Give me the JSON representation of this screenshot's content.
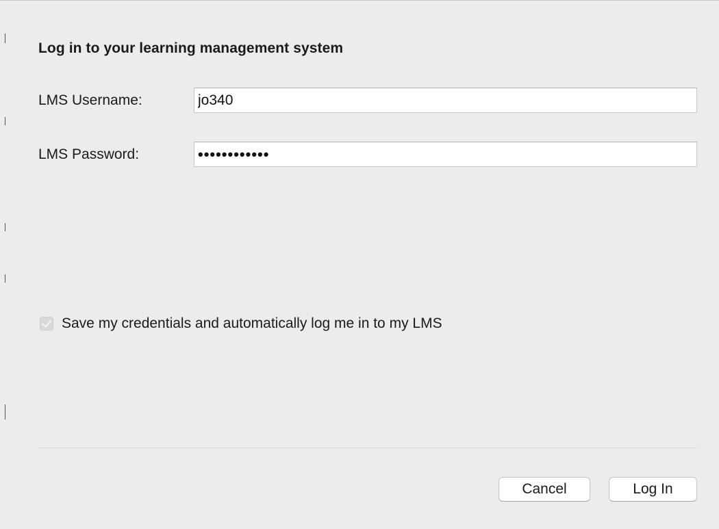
{
  "dialog": {
    "heading": "Log in to your learning management system",
    "username_label": "LMS Username:",
    "username_value": "jo340",
    "password_label": "LMS Password:",
    "password_masked": "••••••••••••",
    "save_credentials_label": "Save my credentials and automatically log me in to my LMS",
    "save_credentials_checked": true,
    "cancel_label": "Cancel",
    "login_label": "Log In"
  }
}
